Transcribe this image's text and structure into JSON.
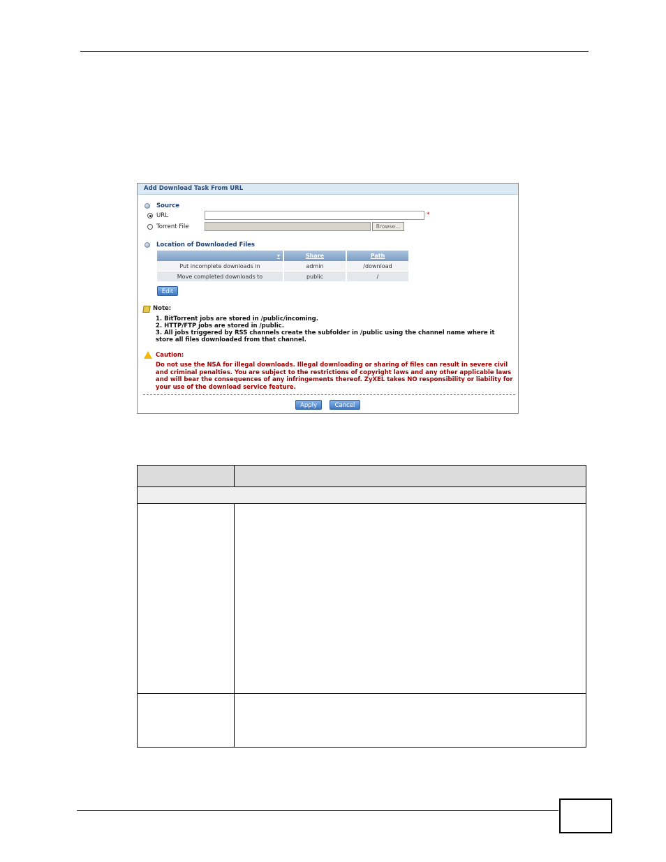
{
  "panel": {
    "title": "Add Download Task From URL",
    "source_label": "Source",
    "url_label": "URL",
    "url_value": "",
    "required_mark": "*",
    "torrent_label": "Torrent File",
    "browse_label": "Browse...",
    "location_label": "Location of Downloaded Files",
    "table": {
      "sort_indicator": "▾",
      "headers": [
        "",
        "Share",
        "Path"
      ],
      "rows": [
        [
          "Put incomplete downloads in",
          "admin",
          "/download"
        ],
        [
          "Move completed downloads to",
          "public",
          "/"
        ]
      ]
    },
    "edit_label": "Edit",
    "note_title": "Note:",
    "notes": [
      "1. BitTorrent jobs are stored in /public/incoming.",
      "2. HTTP/FTP jobs are stored in /public.",
      "3. All jobs triggered by RSS channels create the subfolder in /public using the channel name where it store all files downloaded from that channel."
    ],
    "caution_title": "Caution:",
    "caution_text": "Do not use the NSA for illegal downloads. Illegal downloading or sharing of files can result in severe civil and criminal penalties. You are subject to the restrictions of copyright laws and any other applicable laws and will bear the consequences of any infringements thereof. ZyXEL takes NO responsibility or liability for your use of the download service feature.",
    "apply_label": "Apply",
    "cancel_label": "Cancel"
  },
  "colors": {
    "title_bar": "#dbe9f5",
    "section_text": "#1f3f6e",
    "caution_text": "#a00000",
    "button": "#3d78c4",
    "table_header": "#7b9cc2"
  }
}
